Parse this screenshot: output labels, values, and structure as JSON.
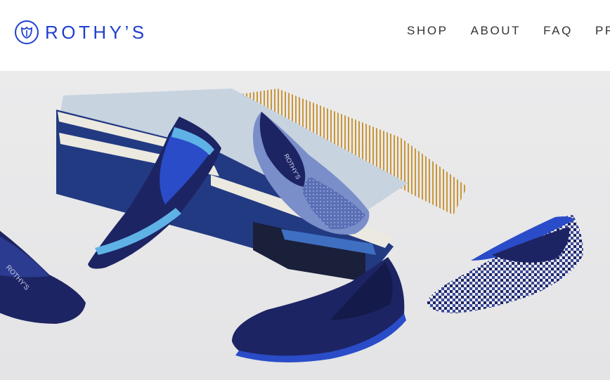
{
  "brand": {
    "name": "ROTHY’S",
    "color": "#1f3fd1"
  },
  "nav": {
    "items": [
      {
        "label": "SHOP"
      },
      {
        "label": "ABOUT"
      },
      {
        "label": "FAQ"
      },
      {
        "label": "PRE"
      }
    ]
  },
  "hero": {
    "shoe_label": "ROTHY’S",
    "colors": {
      "background": "#e9e9ea",
      "navy": "#1d2463",
      "blue": "#2a4cc9",
      "light_blue": "#5fb2e6",
      "fringe": "#c8922e"
    }
  }
}
